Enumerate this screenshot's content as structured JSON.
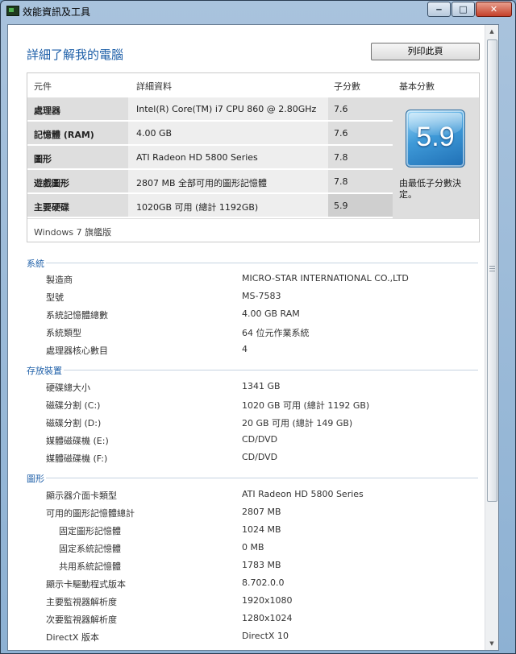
{
  "window": {
    "title": "效能資訊及工具"
  },
  "header": {
    "title": "詳細了解我的電腦",
    "print_label": "列印此頁"
  },
  "scores": {
    "columns": {
      "component": "元件",
      "details": "詳細資料",
      "subscore": "子分數",
      "base": "基本分數"
    },
    "rows": [
      {
        "component": "處理器",
        "details": "Intel(R) Core(TM) i7 CPU 860 @ 2.80GHz",
        "subscore": "7.6"
      },
      {
        "component": "記憶體 (RAM)",
        "details": "4.00 GB",
        "subscore": "7.6"
      },
      {
        "component": "圖形",
        "details": "ATI Radeon HD 5800 Series",
        "subscore": "7.8"
      },
      {
        "component": "遊戲圖形",
        "details": "2807 MB 全部可用的圖形記憶體",
        "subscore": "7.8"
      },
      {
        "component": "主要硬碟",
        "details": "1020GB 可用 (總計 1192GB)",
        "subscore": "5.9"
      }
    ],
    "base_score": "5.9",
    "base_note": "由最低子分數決定。",
    "edition": "Windows 7 旗艦版"
  },
  "system": {
    "title": "系統",
    "items": [
      {
        "label": "製造商",
        "value": "MICRO-STAR INTERNATIONAL CO.,LTD"
      },
      {
        "label": "型號",
        "value": "MS-7583"
      },
      {
        "label": "系統記憶體總數",
        "value": "4.00 GB RAM"
      },
      {
        "label": "系統類型",
        "value": "64 位元作業系統"
      },
      {
        "label": "處理器核心數目",
        "value": "4"
      }
    ]
  },
  "storage": {
    "title": "存放裝置",
    "items": [
      {
        "label": "硬碟總大小",
        "value": "1341 GB"
      },
      {
        "label": "磁碟分割 (C:)",
        "value": "1020 GB 可用 (總計 1192 GB)"
      },
      {
        "label": "磁碟分割 (D:)",
        "value": "20 GB 可用 (總計 149 GB)"
      },
      {
        "label": "媒體磁碟機 (E:)",
        "value": "CD/DVD"
      },
      {
        "label": "媒體磁碟機 (F:)",
        "value": "CD/DVD"
      }
    ]
  },
  "graphics": {
    "title": "圖形",
    "items": [
      {
        "label": "顯示器介面卡類型",
        "value": "ATI Radeon HD 5800 Series"
      },
      {
        "label": "可用的圖形記憶體總計",
        "value": "2807 MB"
      },
      {
        "label": "固定圖形記憶體",
        "value": "1024 MB"
      },
      {
        "label": "固定系統記憶體",
        "value": "0 MB"
      },
      {
        "label": "共用系統記憶體",
        "value": "1783 MB"
      },
      {
        "label": "顯示卡驅動程式版本",
        "value": "8.702.0.0"
      },
      {
        "label": "主要監視器解析度",
        "value": "1920x1080"
      },
      {
        "label": "次要監視器解析度",
        "value": "1280x1024"
      },
      {
        "label": "DirectX 版本",
        "value": "DirectX 10"
      }
    ]
  }
}
